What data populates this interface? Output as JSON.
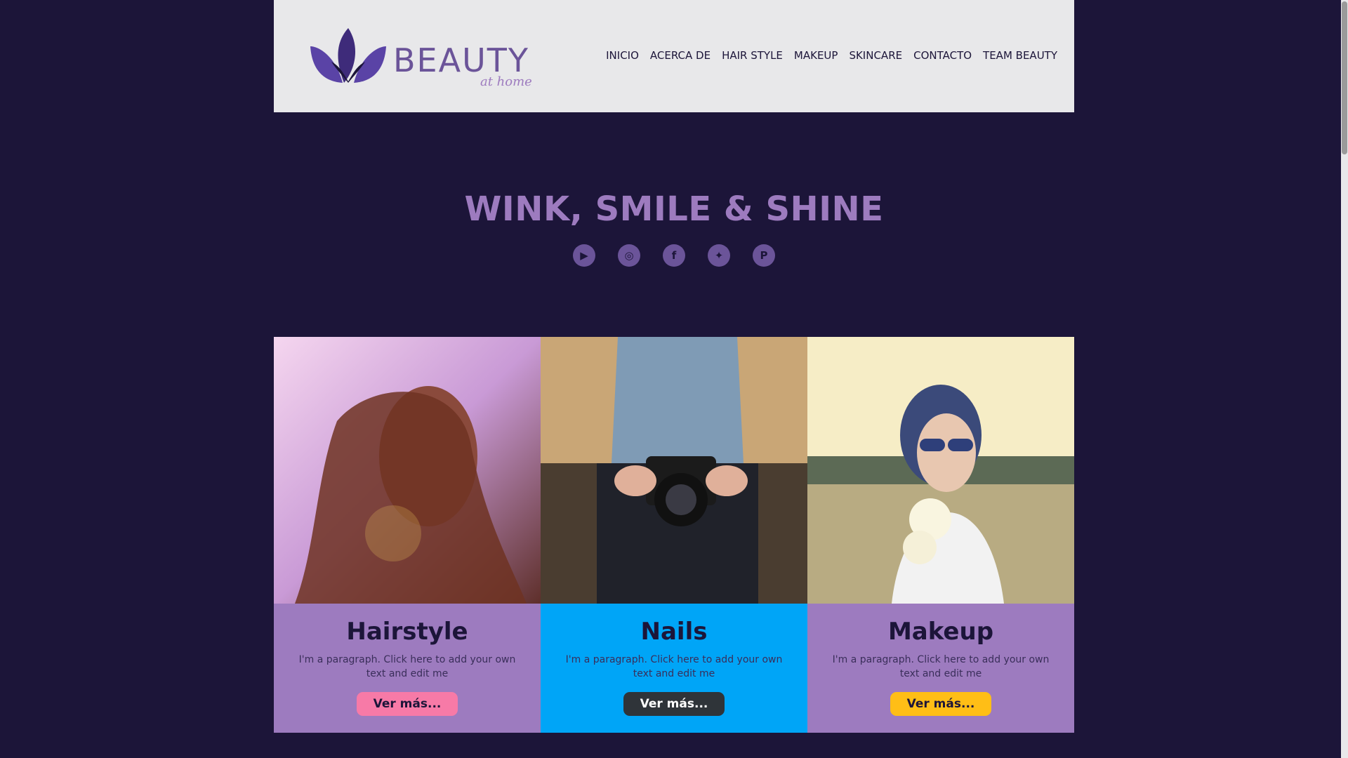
{
  "header": {
    "logo_text": "BEAUTY",
    "logo_sub": "at home",
    "nav": [
      "INICIO",
      "ACERCA DE",
      "HAIR STYLE",
      "MAKEUP",
      "SKINCARE",
      "CONTACTO",
      "TEAM BEAUTY"
    ]
  },
  "hero": {
    "title": "WINK, SMILE & SHINE",
    "social": [
      {
        "icon": "youtube-icon",
        "glyph": "▶"
      },
      {
        "icon": "instagram-icon",
        "glyph": "◎"
      },
      {
        "icon": "facebook-icon",
        "glyph": "f"
      },
      {
        "icon": "twitter-icon",
        "glyph": "✦"
      },
      {
        "icon": "pinterest-icon",
        "glyph": "P"
      }
    ]
  },
  "cards": [
    {
      "title": "Hairstyle",
      "text": "I'm a paragraph. Click here to add your own text and edit me",
      "button": "Ver más...",
      "bg": "#9d7bbf",
      "btn_color": "#f77aa7"
    },
    {
      "title": "Nails",
      "text": "I'm a paragraph. Click here to add your own text and edit me",
      "button": "Ver más...",
      "bg": "#00a5f7",
      "btn_color": "#2f3439"
    },
    {
      "title": "Makeup",
      "text": "I'm a paragraph. Click here to add your own text and edit me",
      "button": "Ver más...",
      "bg": "#9d7bbf",
      "btn_color": "#ffbe16"
    }
  ],
  "colors": {
    "page_bg": "#1c1539",
    "header_bg": "#e8e8ea",
    "accent": "#9d7bbf"
  }
}
